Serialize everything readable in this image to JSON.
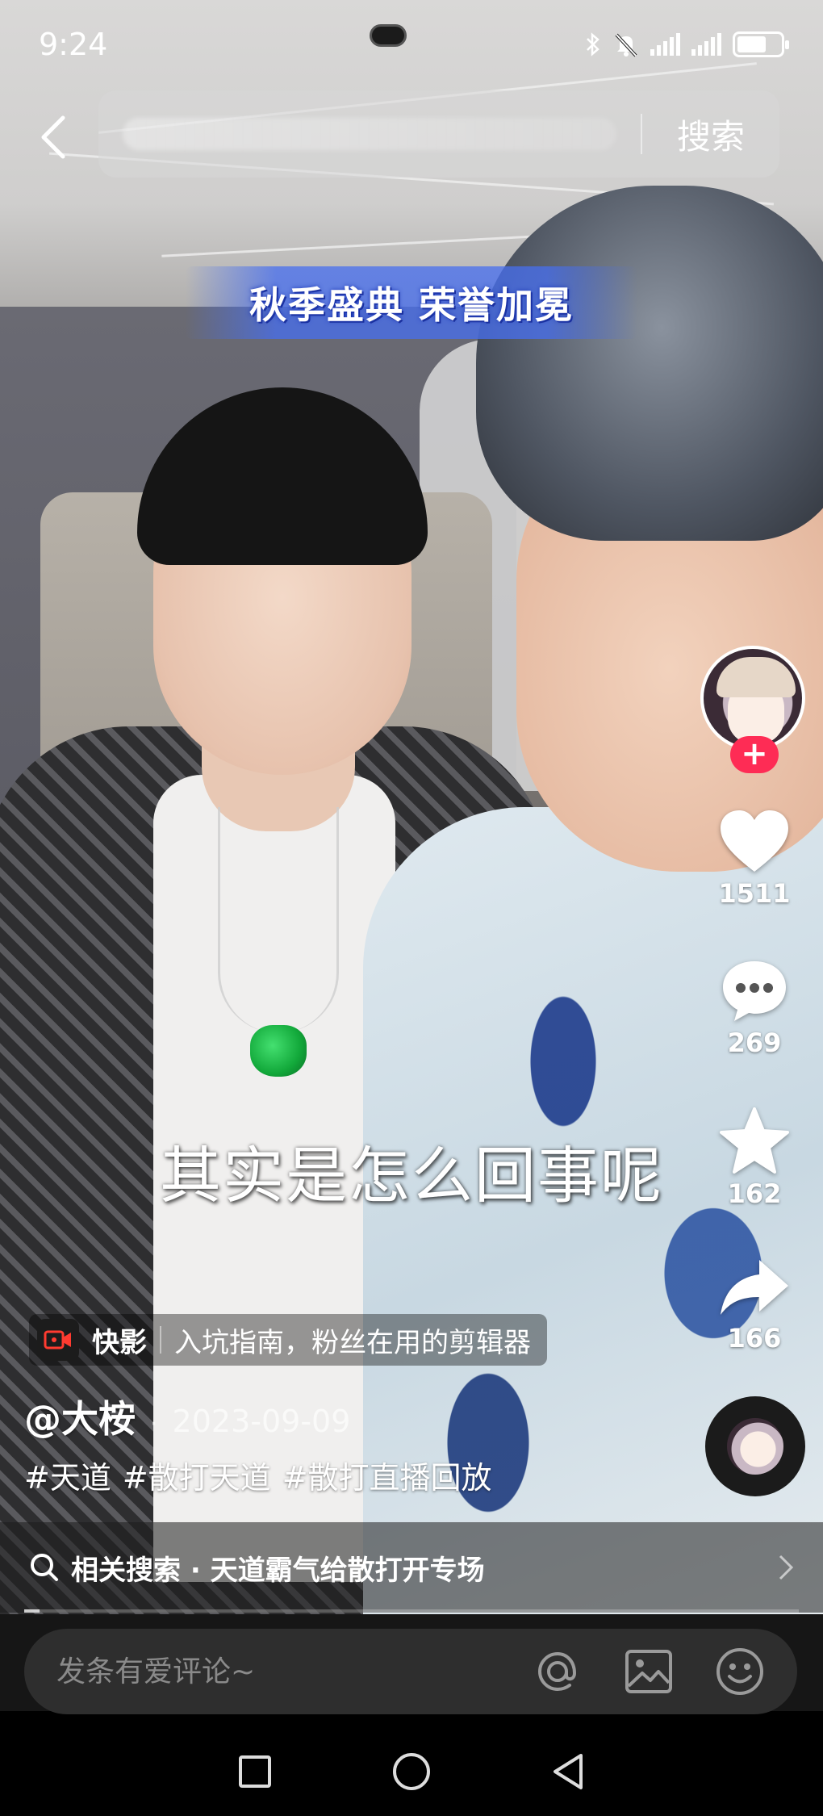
{
  "status_bar": {
    "time": "9:24",
    "battery_level": 0.6
  },
  "search": {
    "button_label": "搜索"
  },
  "video": {
    "banner_text": "秋季盛典 荣誉加冕",
    "subtitle": "其实是怎么回事呢"
  },
  "actions": {
    "likes": "1511",
    "comments": "269",
    "favorites": "162",
    "shares": "166"
  },
  "ad": {
    "brand": "快影",
    "text": "入坑指南，粉丝在用的剪辑器"
  },
  "post": {
    "author": "@大桉",
    "separator": "·",
    "date": "2023-09-09",
    "hashtags": [
      "#天道",
      "#散打天道",
      "#散打直播回放"
    ]
  },
  "related_search": {
    "text": "相关搜索 · 天道霸气给散打开专场"
  },
  "progress": 0.02,
  "comment": {
    "placeholder": "发条有爱评论~"
  },
  "colors": {
    "follow_red": "#fe2c55",
    "comment_bg": "#2e2e2e",
    "ad_icon_red": "#ff3b30"
  },
  "icons": {
    "back": "chevron-left-icon",
    "like": "heart-icon",
    "comment": "speech-bubble-icon",
    "favorite": "star-icon",
    "share": "share-arrow-icon",
    "at": "at-sign-icon",
    "image": "image-icon",
    "emoji": "smiley-icon",
    "search": "magnifier-icon"
  }
}
